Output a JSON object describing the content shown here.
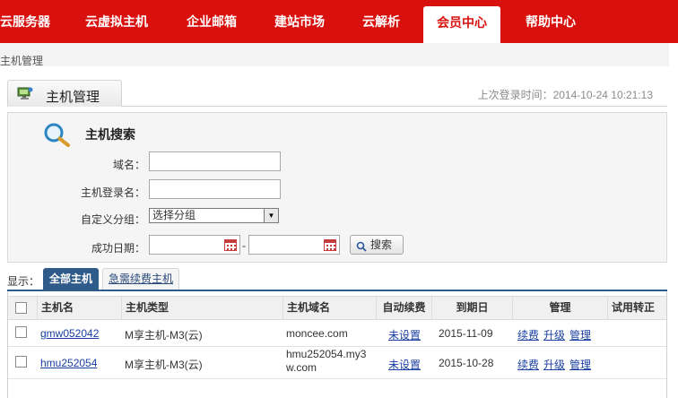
{
  "nav": {
    "items": [
      {
        "label": "云服务器"
      },
      {
        "label": "云虚拟主机"
      },
      {
        "label": "企业邮箱"
      },
      {
        "label": "建站市场"
      },
      {
        "label": "云解析"
      },
      {
        "label": "会员中心",
        "active": true
      },
      {
        "label": "帮助中心"
      }
    ]
  },
  "breadcrumb": "主机管理",
  "panel": {
    "title": "主机管理",
    "last_login": "上次登录时间：2014-10-24 10:21:13"
  },
  "search": {
    "title": "主机搜索",
    "domain_label": "域名：",
    "domain_value": "",
    "login_label": "主机登录名：",
    "login_value": "",
    "group_label": "自定义分组：",
    "group_selected": "选择分组",
    "date_label": "成功日期：",
    "date_from": "",
    "date_to": "",
    "date_separator": "-",
    "button_label": "搜索"
  },
  "filter": {
    "show_label": "显示：",
    "tab_all": "全部主机",
    "tab_renew": "急需续费主机"
  },
  "table": {
    "headers": [
      "主机名",
      "主机类型",
      "主机域名",
      "自动续费",
      "到期日",
      "管理",
      "试用转正"
    ],
    "rows": [
      {
        "name": "gmw052042",
        "type": "M享主机-M3(云)",
        "domain": "moncee.com",
        "auto_renew": "未设置",
        "expires": "2015-11-09",
        "actions": [
          "续费",
          "升级",
          "管理"
        ]
      },
      {
        "name": "hmu252054",
        "type": "M享主机-M3(云)",
        "domain": "hmu252054.my3w.com",
        "auto_renew": "未设置",
        "expires": "2015-10-28",
        "actions": [
          "续费",
          "升级",
          "管理"
        ]
      }
    ]
  },
  "colors": {
    "brand_red": "#d8110e",
    "tab_blue": "#2f5b8a",
    "link_blue": "#1a3fa0"
  },
  "icons": {
    "panel": "host-manage-icon",
    "search": "magnifier-icon",
    "calendar": "calendar-icon",
    "button": "search-button-icon"
  }
}
